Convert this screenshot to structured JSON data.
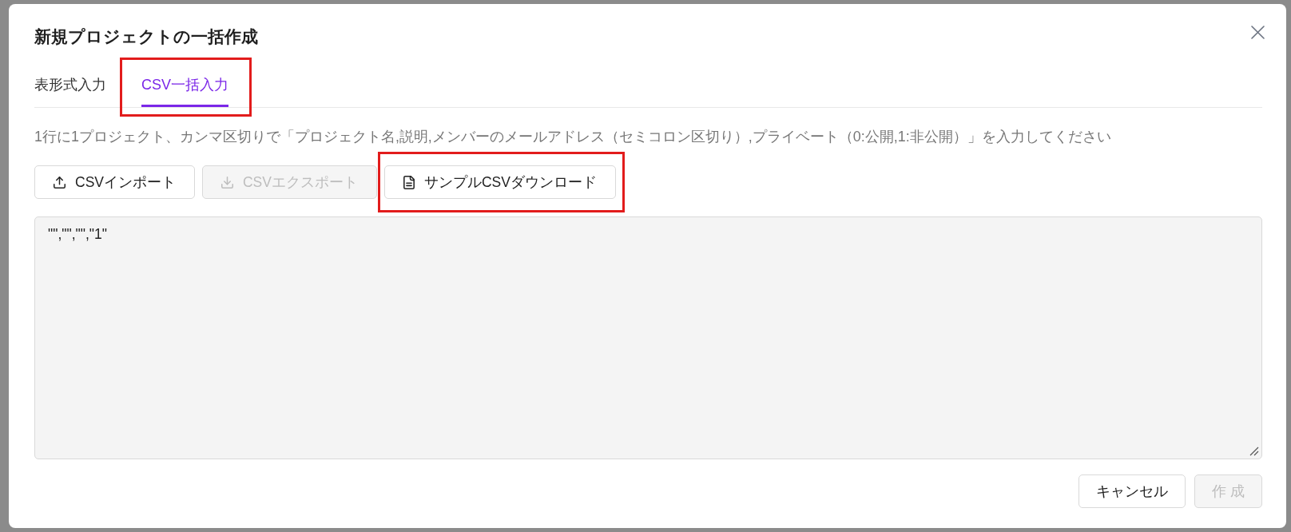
{
  "dialog": {
    "title": "新規プロジェクトの一括作成"
  },
  "tabs": [
    {
      "label": "表形式入力",
      "selected": false,
      "highlighted": false
    },
    {
      "label": "CSV一括入力",
      "selected": true,
      "highlighted": true
    }
  ],
  "instructions": "1行に1プロジェクト、カンマ区切りで「プロジェクト名,説明,メンバーのメールアドレス（セミコロン区切り）,プライベート（0:公開,1:非公開）」を入力してください",
  "actions": [
    {
      "kind": "upload",
      "label": "CSVインポート",
      "disabled": false,
      "highlighted": false
    },
    {
      "kind": "download",
      "label": "CSVエクスポート",
      "disabled": true,
      "highlighted": false
    },
    {
      "kind": "file",
      "label": "サンプルCSVダウンロード",
      "disabled": false,
      "highlighted": true
    }
  ],
  "csv_input": {
    "value": "\"\",\"\",\"\",\"1\""
  },
  "footer_buttons": [
    {
      "label": "キャンセル",
      "disabled": false
    },
    {
      "label": "作 成",
      "disabled": true
    }
  ]
}
